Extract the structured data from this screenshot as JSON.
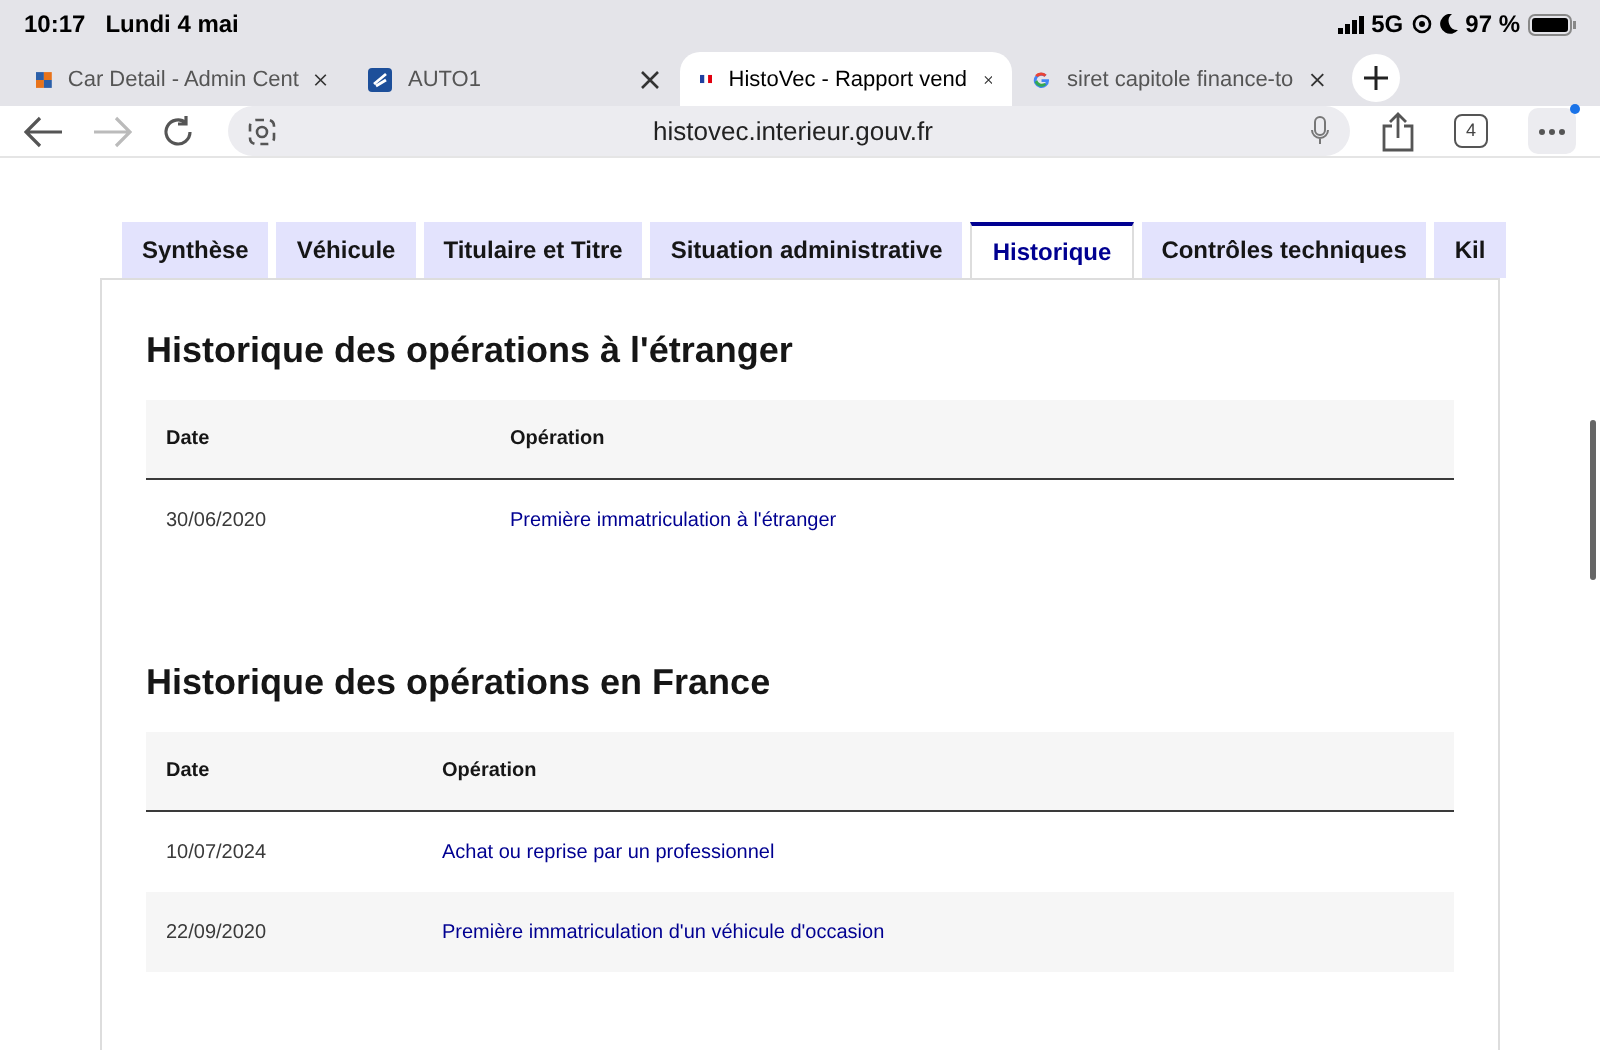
{
  "status_bar": {
    "time": "10:17",
    "date": "Lundi 4 mai",
    "network": "5G",
    "battery": "97 %"
  },
  "browser_tabs": [
    {
      "title": "Car Detail - Admin Cent",
      "selected": false
    },
    {
      "title": "AUTO1",
      "selected": false
    },
    {
      "title": "HistoVec - Rapport vend",
      "selected": true
    },
    {
      "title": "siret capitole finance-to",
      "selected": false
    }
  ],
  "address_bar": {
    "url": "histovec.interieur.gouv.fr",
    "tab_count": "4"
  },
  "page_tabs": [
    {
      "label": "Synthèse",
      "selected": false
    },
    {
      "label": "Véhicule",
      "selected": false
    },
    {
      "label": "Titulaire et Titre",
      "selected": false
    },
    {
      "label": "Situation administrative",
      "selected": false
    },
    {
      "label": "Historique",
      "selected": true
    },
    {
      "label": "Contrôles techniques",
      "selected": false
    },
    {
      "label": "Kil",
      "selected": false
    }
  ],
  "sections": [
    {
      "title": "Historique des opérations à l'étranger",
      "columns": [
        "Date",
        "Opération"
      ],
      "rows": [
        {
          "date": "30/06/2020",
          "operation": "Première immatriculation à l'étranger"
        }
      ]
    },
    {
      "title": "Historique des opérations en France",
      "columns": [
        "Date",
        "Opération"
      ],
      "rows": [
        {
          "date": "10/07/2024",
          "operation": "Achat ou reprise par un professionnel"
        },
        {
          "date": "22/09/2020",
          "operation": "Première immatriculation d'un véhicule d'occasion"
        }
      ]
    }
  ]
}
